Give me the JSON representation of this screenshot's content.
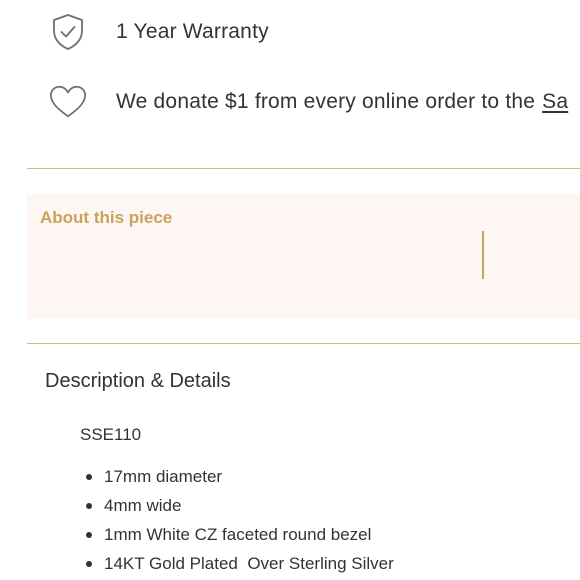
{
  "features": {
    "warranty": {
      "icon": "shield-check-icon",
      "label": "1 Year Warranty"
    },
    "donation": {
      "icon": "heart-icon",
      "label": "We donate $1 from every online order to the",
      "link_label": "Sa"
    }
  },
  "about": {
    "title": "About this piece"
  },
  "description": {
    "title": "Description & Details",
    "sku": "SSE110",
    "items": [
      "17mm diameter",
      "4mm wide",
      "1mm White CZ faceted round bezel",
      "14KT Gold Plated  Over Sterling Silver"
    ]
  },
  "colors": {
    "accent_gold": "#c8a45a",
    "divider": "#cdbd86",
    "panel_bg": "#fdf6f3",
    "text": "#333333"
  }
}
